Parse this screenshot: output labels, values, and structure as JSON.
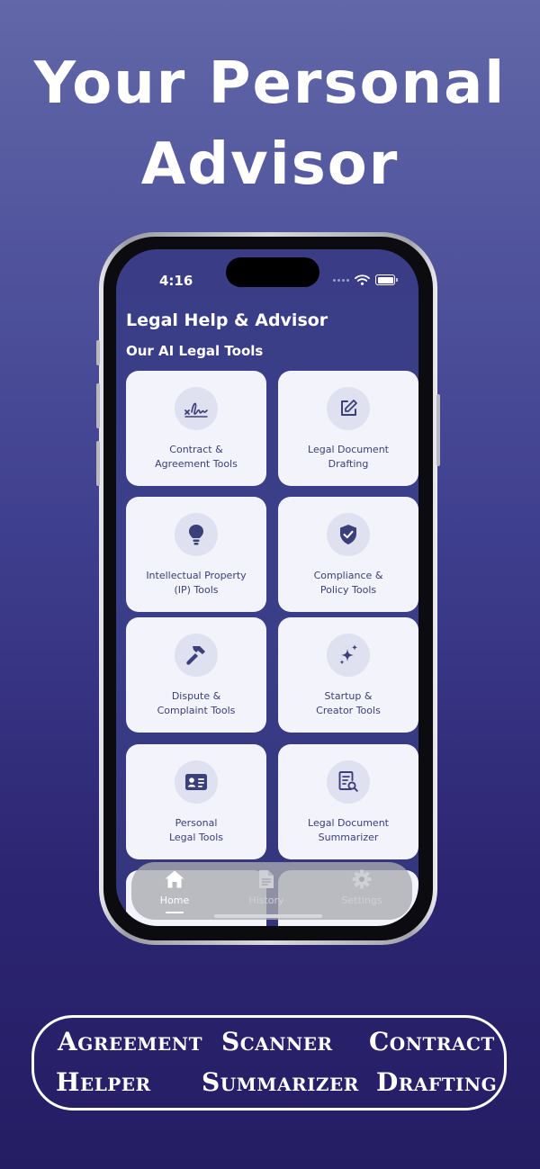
{
  "headline": {
    "line1": "Your Personal",
    "line2": "Advisor"
  },
  "status_bar": {
    "time": "4:16"
  },
  "app": {
    "title": "Legal Help & Advisor",
    "section_title": "Our AI Legal Tools",
    "tools": [
      {
        "line1": "Contract &",
        "line2": "Agreement Tools",
        "icon": "signature-icon"
      },
      {
        "line1": "Legal Document",
        "line2": "Drafting",
        "icon": "edit-document-icon"
      },
      {
        "line1": "Intellectual Property",
        "line2": "(IP) Tools",
        "icon": "lightbulb-icon"
      },
      {
        "line1": "Compliance &",
        "line2": "Policy Tools",
        "icon": "shield-check-icon"
      },
      {
        "line1": "Dispute &",
        "line2": "Complaint Tools",
        "icon": "hammer-icon"
      },
      {
        "line1": "Startup &",
        "line2": "Creator Tools",
        "icon": "sparkles-icon"
      },
      {
        "line1": "Personal",
        "line2": "Legal Tools",
        "icon": "id-card-icon"
      },
      {
        "line1": "Legal Document",
        "line2": "Summarizer",
        "icon": "document-search-icon"
      }
    ],
    "tabs": [
      {
        "label": "Home",
        "icon": "home-icon",
        "active": true
      },
      {
        "label": "History",
        "icon": "document-icon",
        "active": false
      },
      {
        "label": "Settings",
        "icon": "gear-icon",
        "active": false
      }
    ]
  },
  "badge": {
    "words": [
      "Agreement",
      "Scanner",
      "Contract",
      "Helper",
      "Summarizer",
      "Drafting"
    ]
  },
  "colors": {
    "card_bg": "#f2f3fb",
    "icon_color": "#3b3f7a",
    "screen_bg": "#3a3d86",
    "icon_circle": "#dfe1f0"
  }
}
